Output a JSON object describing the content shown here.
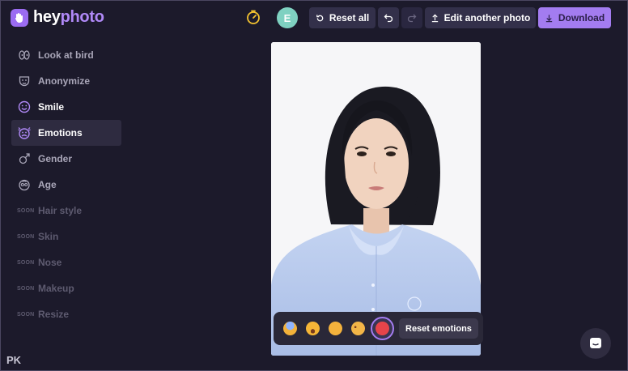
{
  "app": {
    "logo_text_a": "hey",
    "logo_text_b": "photo"
  },
  "header": {
    "avatar_initial": "E",
    "reset_all": "Reset all",
    "edit_another": "Edit another photo",
    "download": "Download",
    "icons": {
      "timer": "timer-icon",
      "undo": "undo-icon",
      "redo": "redo-icon",
      "upload": "upload-icon",
      "download": "download-icon",
      "reset": "reset-icon"
    }
  },
  "sidebar": {
    "items": [
      {
        "label": "Look at bird",
        "icon": "eyes-icon"
      },
      {
        "label": "Anonymize",
        "icon": "mask-icon"
      },
      {
        "label": "Smile",
        "icon": "smile-icon"
      },
      {
        "label": "Emotions",
        "icon": "emotions-icon",
        "active": true
      },
      {
        "label": "Gender",
        "icon": "gender-icon"
      },
      {
        "label": "Age",
        "icon": "age-icon"
      },
      {
        "label": "Hair style",
        "soon": "SOON"
      },
      {
        "label": "Skin",
        "soon": "SOON"
      },
      {
        "label": "Nose",
        "soon": "SOON"
      },
      {
        "label": "Makeup",
        "soon": "SOON"
      },
      {
        "label": "Resize",
        "soon": "SOON"
      }
    ]
  },
  "emotions": {
    "options": [
      "fear",
      "surprise",
      "neutral",
      "sad",
      "angry"
    ],
    "selected": "angry",
    "reset_label": "Reset emotions"
  },
  "watermark": "PK",
  "colors": {
    "accent": "#a37cf0",
    "background": "#1c1a2b",
    "avatar": "#7fd1c1"
  }
}
